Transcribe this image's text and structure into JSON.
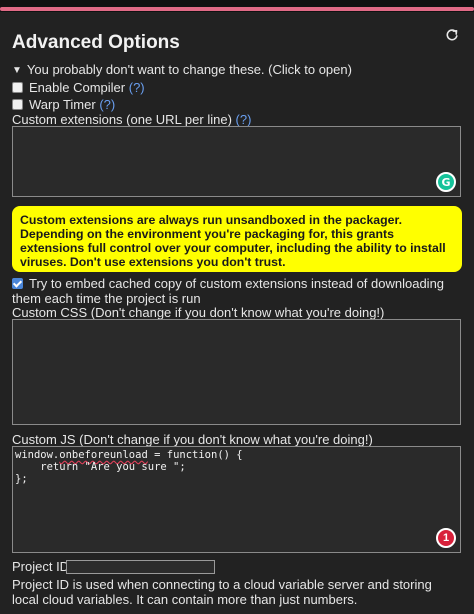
{
  "title": "Advanced Options",
  "toggle_text": "You probably don't want to change these. (Click to open)",
  "options": {
    "enable_compiler": {
      "label": "Enable Compiler",
      "help": "(?)",
      "checked": false
    },
    "warp_timer": {
      "label": "Warp Timer",
      "help": "(?)",
      "checked": false
    }
  },
  "custom_extensions": {
    "label": "Custom extensions (one URL per line)",
    "help": "(?)",
    "value": "",
    "grammarly_icon": "G"
  },
  "warning_text": "Custom extensions are always run unsandboxed in the packager. Depending on the environment you're packaging for, this grants extensions full control over your computer, including the ability to install viruses. Don't use extensions you don't trust.",
  "embed_extensions": {
    "label": "Try to embed cached copy of custom extensions instead of downloading them each time the project is run",
    "checked": true
  },
  "custom_css": {
    "label": "Custom CSS (Don't change if you don't know what you're doing!)",
    "value": ""
  },
  "custom_js": {
    "label": "Custom JS (Don't change if you don't know what you're doing!)",
    "code_prefix": "window.",
    "code_flagged": "onbeforeunload",
    "code_rest": " = function() {\n    return \"Are you sure \";\n};",
    "issue_count": "1"
  },
  "project_id": {
    "label": "Project ID",
    "value": "",
    "note": "Project ID is used when connecting to a cloud variable server and storing local cloud variables. It can contain more than just numbers."
  },
  "colors": {
    "accent": "#e06a86",
    "warning_bg": "#ffff00",
    "link": "#6a9ff0",
    "badge": "#d8213b",
    "grammarly": "#15c39a"
  },
  "icons": {
    "reset": "reset-icon",
    "toggle": "triangle-down-icon"
  }
}
